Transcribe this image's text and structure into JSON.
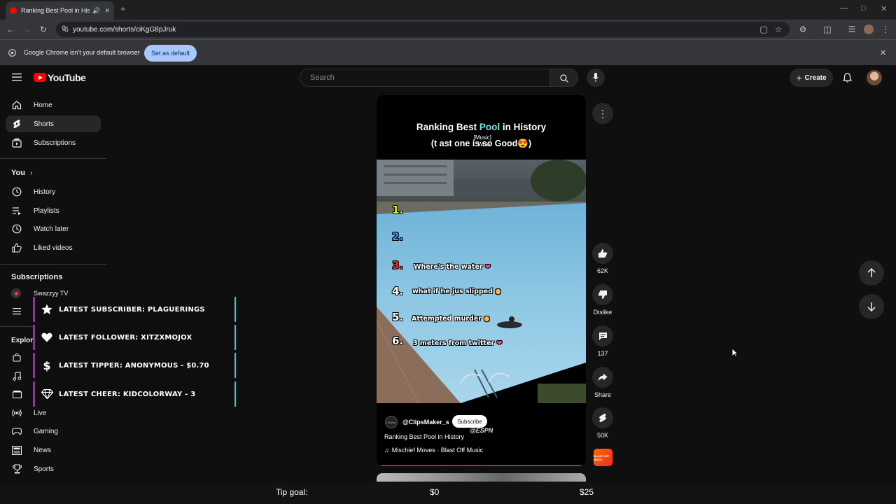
{
  "browser": {
    "tab_title": "Ranking Best Pool in Histor",
    "url": "youtube.com/shorts/ciKgG8pJruk",
    "infobar_text": "Google Chrome isn't your default browser",
    "set_default_label": "Set as default"
  },
  "youtube": {
    "logo_text": "YouTube",
    "search_placeholder": "Search",
    "create_label": "Create"
  },
  "sidebar": {
    "main": [
      {
        "label": "Home",
        "icon": "home-icon"
      },
      {
        "label": "Shorts",
        "icon": "shorts-icon"
      },
      {
        "label": "Subscriptions",
        "icon": "subscriptions-icon"
      }
    ],
    "you_heading": "You",
    "you_items": [
      {
        "label": "History",
        "icon": "history-icon"
      },
      {
        "label": "Playlists",
        "icon": "playlists-icon"
      },
      {
        "label": "Watch later",
        "icon": "watch-later-icon"
      },
      {
        "label": "Liked videos",
        "icon": "liked-videos-icon"
      }
    ],
    "subscriptions_heading": "Subscriptions",
    "subscription_channel": "Swazzyy TV",
    "explore_heading": "Explore",
    "explore_items": [
      {
        "label": "Live",
        "icon": "live-icon"
      },
      {
        "label": "Gaming",
        "icon": "gaming-icon"
      },
      {
        "label": "News",
        "icon": "news-icon"
      },
      {
        "label": "Sports",
        "icon": "sports-icon"
      }
    ]
  },
  "overlay_alerts": [
    {
      "text": "LATEST SUBSCRIBER: PLAGUERINGS",
      "icon": "star-icon"
    },
    {
      "text": "LATEST FOLLOWER: XITZXMOJOX",
      "icon": "heart-icon"
    },
    {
      "text": "LATEST TIPPER: ANONYMOUS - $0.70",
      "icon": "dollar-icon"
    },
    {
      "text": "LATEST CHEER: KIDCOLORWAY - 3",
      "icon": "diamond-icon"
    }
  ],
  "short": {
    "title_part1": "Ranking Best ",
    "title_highlight": "Pool",
    "title_part2": " in History",
    "subtitle": "(t   ast one is so Good😍)",
    "caption_line1": "[Music]",
    "caption_line2": "Wow.",
    "ranks": [
      {
        "num": "1.",
        "text": "",
        "color": "#d8f03a"
      },
      {
        "num": "2.",
        "text": "",
        "color": "#3a8ee6"
      },
      {
        "num": "3.",
        "text": "Where's the water",
        "color": "#e8303a"
      },
      {
        "num": "4.",
        "text": "what if he jus slipped",
        "color": "#ffffff"
      },
      {
        "num": "5.",
        "text": "Attempted murder",
        "color": "#ffffff"
      },
      {
        "num": "6.",
        "text": "3 meters from twitter",
        "color": "#ffffff"
      }
    ],
    "channel_avatar_text": "ClipMkr",
    "channel": "@ClipsMaker_s",
    "subscribe_label": "Subscribe",
    "watermark": "@ESPN",
    "video_title": "Ranking Best Pool in History",
    "music": "Mischief Moves · Blast Off Music",
    "progress": 0.53
  },
  "actions": {
    "likes": "62K",
    "dislike_label": "Dislike",
    "comments": "137",
    "share_label": "Share",
    "remix_count": "50K",
    "sound_thumb_text": "BLAST OFF MUSIC"
  },
  "tip_goal": {
    "label": "Tip goal:",
    "current": "$0",
    "target": "$25",
    "progress": 0.0
  },
  "colors": {
    "youtube_red": "#ff0000",
    "overlay_purple": "#9b27af",
    "overlay_cyan": "#39c4d4",
    "progress_red": "#ff0033",
    "infobar_button": "#a8c7fa"
  }
}
